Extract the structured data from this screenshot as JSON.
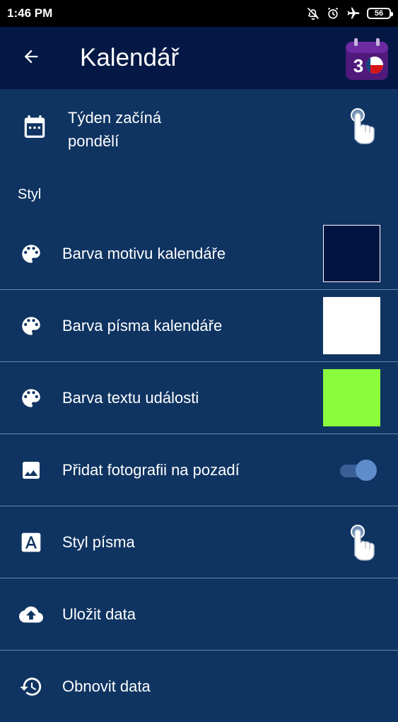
{
  "status_bar": {
    "time": "1:46 PM",
    "battery": "56",
    "icons": [
      "bell-off-icon",
      "alarm-icon",
      "airplane-icon",
      "battery-icon"
    ]
  },
  "app_bar": {
    "title": "Kalendář",
    "back_icon": "arrow-left-icon",
    "logo_number": "3"
  },
  "week_start": {
    "label": "Týden začíná pondělí",
    "icon": "calendar-icon"
  },
  "section_style": {
    "title": "Styl"
  },
  "settings": [
    {
      "label": "Barva motivu kalendáře",
      "icon": "palette-icon",
      "control": "swatch",
      "color": "#001542"
    },
    {
      "label": "Barva písma kalendáře",
      "icon": "palette-icon",
      "control": "swatch",
      "color": "#ffffff"
    },
    {
      "label": "Barva textu události",
      "icon": "palette-icon",
      "control": "swatch",
      "color": "#8afc3c"
    },
    {
      "label": "Přidat fotografii na pozadí",
      "icon": "image-icon",
      "control": "toggle",
      "on": true
    },
    {
      "label": "Styl písma",
      "icon": "font-icon",
      "control": "tap"
    },
    {
      "label": "Uložit data",
      "icon": "cloud-upload-icon",
      "control": "none"
    },
    {
      "label": "Obnovit data",
      "icon": "restore-icon",
      "control": "none"
    }
  ],
  "colors": {
    "background": "#0f3461",
    "app_bar": "#031845",
    "divider": "#6a87a8",
    "toggle_thumb": "#5e8ccc",
    "toggle_track": "#3a5f96"
  }
}
